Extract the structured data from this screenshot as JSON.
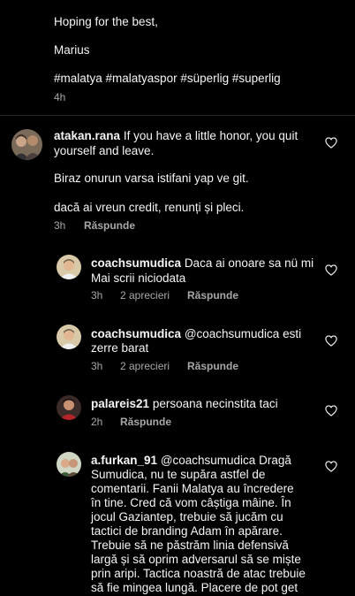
{
  "post_caption": {
    "signoff": "Hoping for the best,",
    "name": "Marius",
    "hashtags": "#malatya #malatyaspor #süperlig #superlig",
    "time": "4h"
  },
  "comments": [
    {
      "username": "atakan.rana",
      "text_line1": "If you have a little honor, you quit",
      "text_line2": "yourself and leave.",
      "text_p2": "Biraz onurun varsa istifani yap ve git.",
      "text_p3": "dacă ai vreun credit, renunți și pleci.",
      "time": "3h",
      "reply": "Răspunde"
    }
  ],
  "replies": [
    {
      "username": "coachsumudica",
      "text_line1": "Daca ai onoare sa nü mi",
      "text_line2": "Mai scrii niciodata",
      "time": "3h",
      "likes": "2 aprecieri",
      "reply": "Răspunde"
    },
    {
      "username": "coachsumudica",
      "text_line1": "@coachsumudica esti",
      "text_line2": "zerre barat",
      "time": "3h",
      "likes": "2 aprecieri",
      "reply": "Răspunde"
    },
    {
      "username": "palareis21",
      "text_line1": "persoana necinstita taci",
      "time": "2h",
      "reply": "Răspunde"
    },
    {
      "username": "a.furkan_91",
      "lines": [
        "@coachsumudica Dragă",
        "Sumudica, nu te supăra astfel de",
        "comentarii. Fanii Malatya au încredere",
        "în tine. Cred că vom câștiga mâine. În",
        "jocul Gaziantep, trebuie să jucăm cu",
        "tactici de branding Adam în apărare.",
        "Trebuie să ne păstrăm linia defensivă",
        "largă și să oprim adversarul să se miște",
        "prin aripi. Tactica noastră de atac trebuie",
        "să fie mingea lungă. Placere de pot get"
      ]
    }
  ],
  "colors": {
    "background": "#000000",
    "text": "#f5f5f5",
    "meta": "#a8a8a8"
  },
  "icons": {
    "heart": "heart-outline-icon"
  }
}
